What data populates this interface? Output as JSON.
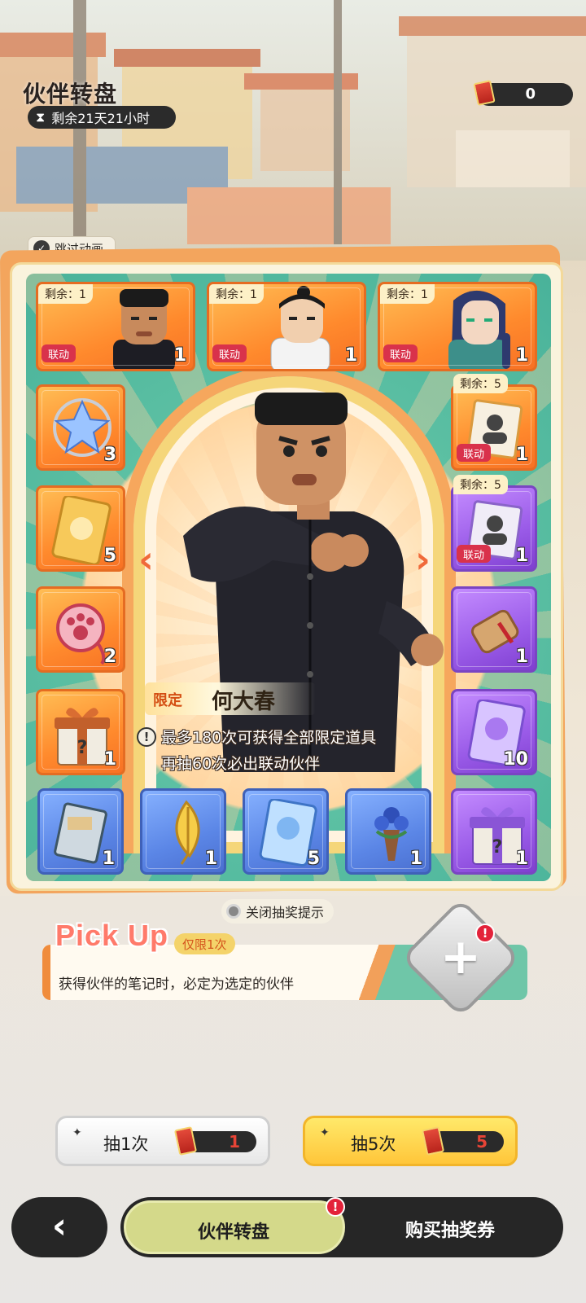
{
  "header": {
    "title": "伙伴转盘",
    "timer": "剩余21天21小时",
    "ticket_count": "0"
  },
  "skip_animation": "跳过动画",
  "top_row": [
    {
      "remain": "剩余：1",
      "qty": "1",
      "badge": "联动",
      "icon": "partner-portrait-icon"
    },
    {
      "remain": "剩余：1",
      "qty": "1",
      "badge": "联动",
      "icon": "partner-portrait-icon"
    },
    {
      "remain": "剩余：1",
      "qty": "1",
      "badge": "联动",
      "icon": "partner-portrait-icon"
    }
  ],
  "left_col": [
    {
      "qty": "3",
      "icon": "ice-crystal-icon"
    },
    {
      "qty": "5",
      "icon": "gold-card-icon"
    },
    {
      "qty": "2",
      "icon": "paw-charm-icon"
    },
    {
      "qty": "1",
      "icon": "mystery-gift-icon"
    }
  ],
  "right_col": [
    {
      "remain": "剩余：5",
      "qty": "1",
      "badge": "联动",
      "icon": "mystery-portrait-card-icon"
    },
    {
      "remain": "剩余：5",
      "qty": "1",
      "badge": "联动",
      "icon": "mystery-portrait-card-icon"
    },
    {
      "qty": "1",
      "icon": "scroll-icon"
    },
    {
      "qty": "10",
      "icon": "purple-card-icon"
    }
  ],
  "bottom_row": [
    {
      "qty": "1",
      "icon": "notebook-card-icon"
    },
    {
      "qty": "1",
      "icon": "golden-leaf-icon"
    },
    {
      "qty": "5",
      "icon": "blue-card-icon"
    },
    {
      "qty": "1",
      "icon": "flower-bouquet-icon"
    },
    {
      "qty": "1",
      "icon": "purple-gift-icon"
    }
  ],
  "featured": {
    "tag": "限定",
    "name": "何大春",
    "hint_line1": "最多180次可获得全部限定道具",
    "hint_line2": "再抽60次必出联动伙伴"
  },
  "close_tips": "关闭抽奖提示",
  "pickup": {
    "title": "Pick Up",
    "limit": "仅限1次",
    "desc": "获得伙伴的笔记时，必定为选定的伙伴",
    "alert": "!"
  },
  "draw": {
    "one_label": "抽1次",
    "one_cost": "1",
    "five_label": "抽5次",
    "five_cost": "5"
  },
  "nav": {
    "active": "伙伴转盘",
    "buy": "购买抽奖券",
    "alert": "!"
  },
  "colors": {
    "orange_tile": "#ff8a2d",
    "purple_tile": "#9a5be8",
    "blue_tile": "#5b86e6",
    "link_badge": "#d9324b",
    "nav_active": "#d4d98a"
  }
}
